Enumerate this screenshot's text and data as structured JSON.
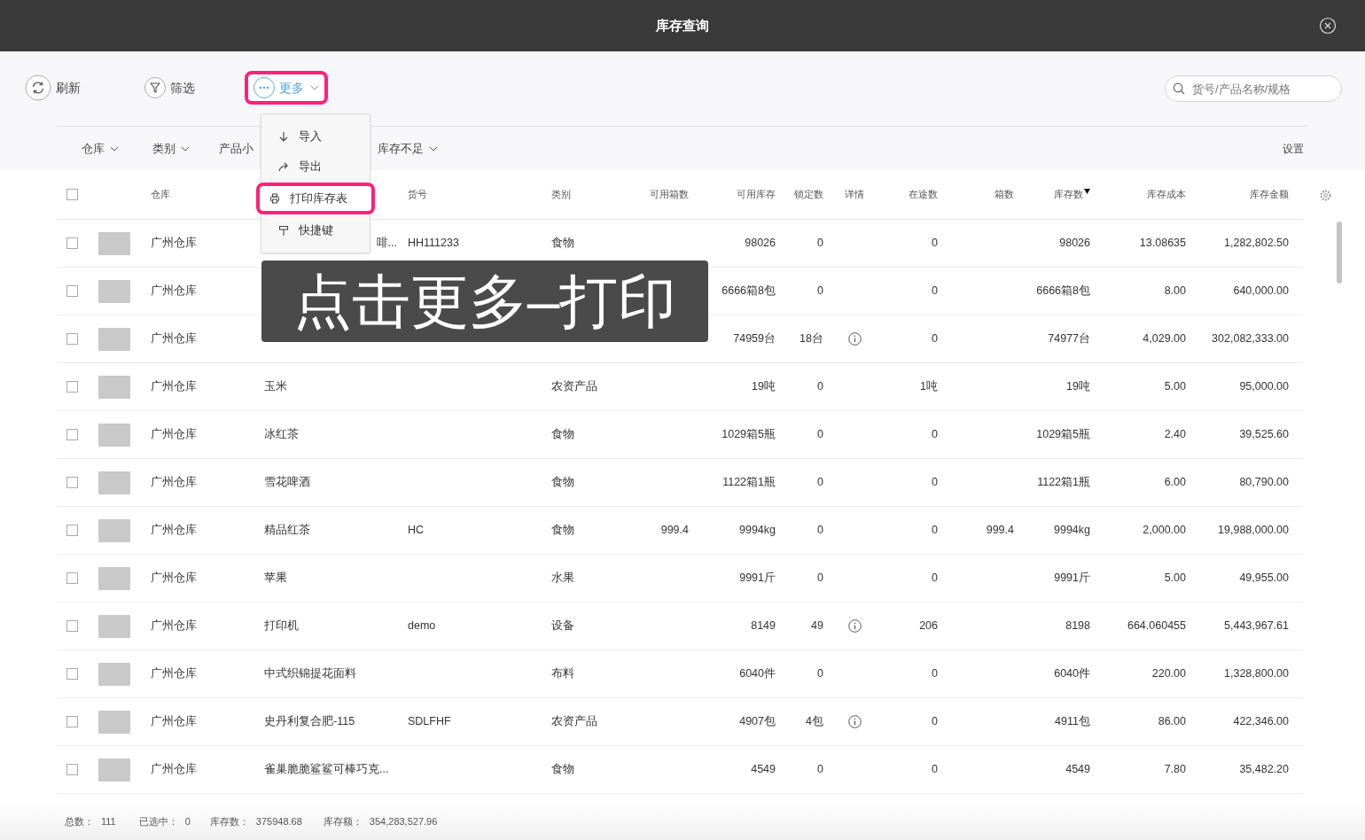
{
  "window": {
    "title": "库存查询"
  },
  "toolbar": [
    {
      "kind": "refresh",
      "label": "刷新",
      "selected": false,
      "highlighted": false
    },
    {
      "kind": "filter",
      "label": "筛选",
      "selected": false,
      "highlighted": false
    },
    {
      "kind": "more",
      "label": "更多",
      "selected": true,
      "highlighted": true
    }
  ],
  "menu": {
    "items": [
      {
        "kind": "import",
        "label": "导入",
        "highlighted": false
      },
      {
        "kind": "export",
        "label": "导出",
        "highlighted": false
      },
      {
        "kind": "print",
        "label": "打印库存表",
        "highlighted": true
      },
      {
        "kind": "shortcut",
        "label": "快捷键",
        "highlighted": false
      }
    ]
  },
  "search": {
    "placeholder": "货号/产品名称/规格"
  },
  "filters": [
    {
      "label": "仓库",
      "dropdown": true
    },
    {
      "label": "类别",
      "dropdown": true
    },
    {
      "label": "产品小",
      "dropdown": false
    },
    {
      "label": "库存不足",
      "dropdown": true
    }
  ],
  "settings_label": "设置",
  "table": {
    "all_checked": false,
    "columns": [
      {
        "label": "仓库",
        "sorted": false
      },
      {
        "sorted": false
      },
      {
        "label": "货号",
        "sorted": false
      },
      {
        "label": "类别",
        "sorted": false
      },
      {
        "label": "可用箱数",
        "sorted": false
      },
      {
        "label": "可用库存",
        "sorted": false
      },
      {
        "label": "锁定数",
        "sorted": false
      },
      {
        "label": "详情",
        "sorted": false
      },
      {
        "label": "在途数",
        "sorted": false
      },
      {
        "label": "箱数",
        "sorted": false
      },
      {
        "label": "库存数",
        "sorted": true
      },
      {
        "label": "库存成本",
        "sorted": false
      },
      {
        "label": "库存金额",
        "sorted": false
      }
    ],
    "rows": [
      {
        "checked": false,
        "cells": [
          "广州仓库",
          "啡...",
          "HH111233",
          "食物",
          "",
          "98026",
          "0",
          "",
          "0",
          "",
          "98026",
          "13.08635",
          "1,282,802.50"
        ],
        "info": false,
        "name_covered": true
      },
      {
        "checked": false,
        "cells": [
          "广州仓库",
          "",
          "",
          "",
          "",
          "6666箱8包",
          "0",
          "",
          "0",
          "",
          "6666箱8包",
          "8.00",
          "640,000.00"
        ],
        "info": false,
        "name_covered": false
      },
      {
        "checked": false,
        "cells": [
          "广州仓库",
          "",
          "",
          "",
          "",
          "74959台",
          "18台",
          "",
          "0",
          "",
          "74977台",
          "4,029.00",
          "302,082,333.00"
        ],
        "info": true,
        "name_covered": false
      },
      {
        "checked": false,
        "cells": [
          "广州仓库",
          "玉米",
          "",
          "农资产品",
          "",
          "19吨",
          "0",
          "",
          "1吨",
          "",
          "19吨",
          "5.00",
          "95,000.00"
        ],
        "info": false,
        "name_covered": false
      },
      {
        "checked": false,
        "cells": [
          "广州仓库",
          "冰红茶",
          "",
          "食物",
          "",
          "1029箱5瓶",
          "0",
          "",
          "0",
          "",
          "1029箱5瓶",
          "2.40",
          "39,525.60"
        ],
        "info": false,
        "name_covered": false
      },
      {
        "checked": false,
        "cells": [
          "广州仓库",
          "雪花啤酒",
          "",
          "食物",
          "",
          "1122箱1瓶",
          "0",
          "",
          "0",
          "",
          "1122箱1瓶",
          "6.00",
          "80,790.00"
        ],
        "info": false,
        "name_covered": false
      },
      {
        "checked": false,
        "cells": [
          "广州仓库",
          "精品红茶",
          "HC",
          "食物",
          "999.4",
          "9994kg",
          "0",
          "",
          "0",
          "999.4",
          "9994kg",
          "2,000.00",
          "19,988,000.00"
        ],
        "info": false,
        "name_covered": false
      },
      {
        "checked": false,
        "cells": [
          "广州仓库",
          "苹果",
          "",
          "水果",
          "",
          "9991斤",
          "0",
          "",
          "0",
          "",
          "9991斤",
          "5.00",
          "49,955.00"
        ],
        "info": false,
        "name_covered": false
      },
      {
        "checked": false,
        "cells": [
          "广州仓库",
          "打印机",
          "demo",
          "设备",
          "",
          "8149",
          "49",
          "",
          "206",
          "",
          "8198",
          "664.060455",
          "5,443,967.61"
        ],
        "info": true,
        "name_covered": false
      },
      {
        "checked": false,
        "cells": [
          "广州仓库",
          "中式织锦提花面料",
          "",
          "布料",
          "",
          "6040件",
          "0",
          "",
          "0",
          "",
          "6040件",
          "220.00",
          "1,328,800.00"
        ],
        "info": false,
        "name_covered": false
      },
      {
        "checked": false,
        "cells": [
          "广州仓库",
          "史丹利复合肥-115",
          "SDLFHF",
          "农资产品",
          "",
          "4907包",
          "4包",
          "",
          "0",
          "",
          "4911包",
          "86.00",
          "422,346.00"
        ],
        "info": true,
        "name_covered": false
      },
      {
        "checked": false,
        "cells": [
          "广州仓库",
          "雀巢脆脆鲨鲨可棒巧克...",
          "",
          "食物",
          "",
          "4549",
          "0",
          "",
          "0",
          "",
          "4549",
          "7.80",
          "35,482.20"
        ],
        "info": false,
        "name_covered": false
      }
    ]
  },
  "status_bar": [
    {
      "label": "总数：",
      "value": "111"
    },
    {
      "label": "已选中：",
      "value": "0"
    },
    {
      "label": "库存数：",
      "value": "375948.68"
    },
    {
      "label": "库存额：",
      "value": "354,283,527.96"
    }
  ],
  "caption": "点击更多–打印"
}
